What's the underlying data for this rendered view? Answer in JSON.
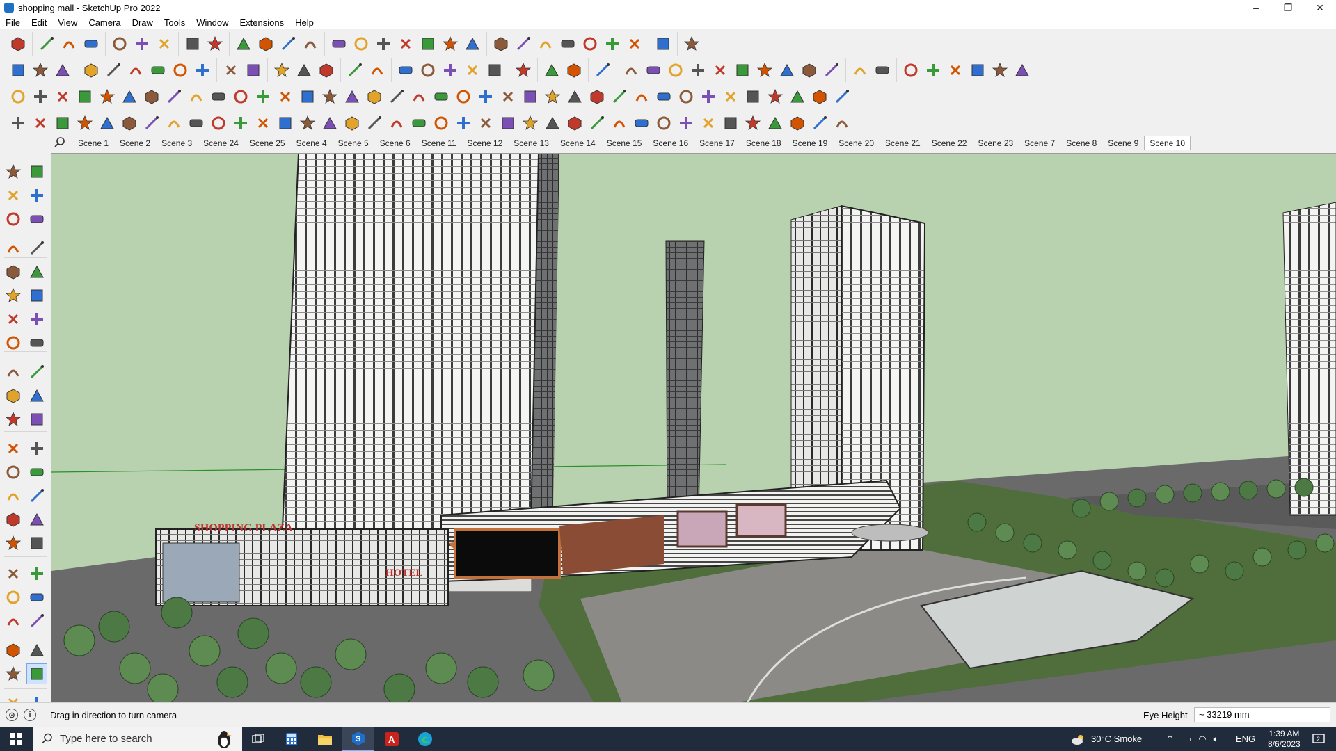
{
  "window": {
    "title": "shopping mall - SketchUp Pro 2022",
    "minimize": "–",
    "maximize": "❐",
    "close": "✕"
  },
  "menu": [
    "File",
    "Edit",
    "View",
    "Camera",
    "Draw",
    "Tools",
    "Window",
    "Extensions",
    "Help"
  ],
  "scenes": {
    "tabs": [
      "Scene 1",
      "Scene 2",
      "Scene 3",
      "Scene 24",
      "Scene 25",
      "Scene 4",
      "Scene 5",
      "Scene 6",
      "Scene 11",
      "Scene 12",
      "Scene 13",
      "Scene 14",
      "Scene 15",
      "Scene 16",
      "Scene 17",
      "Scene 18",
      "Scene 19",
      "Scene 20",
      "Scene 21",
      "Scene 22",
      "Scene 23",
      "Scene 7",
      "Scene 8",
      "Scene 9",
      "Scene 10"
    ],
    "active": "Scene 10"
  },
  "viewport": {
    "sign_mall": "SHOPPING PLAZA",
    "sign_hotel": "HOTEL"
  },
  "status": {
    "hint": "Drag in direction to turn camera",
    "measure_label": "Eye Height",
    "measure_value": "~ 33219 mm"
  },
  "taskbar": {
    "search_placeholder": "Type here to search",
    "weather": "30°C  Smoke",
    "language": "ENG",
    "time": "1:39 AM",
    "date": "8/6/2023"
  },
  "colors": {
    "sky": "#b8d1ae",
    "accent_red": "#d23a2a",
    "accent_blue": "#1f6fc5",
    "taskbar": "#202b3b"
  }
}
